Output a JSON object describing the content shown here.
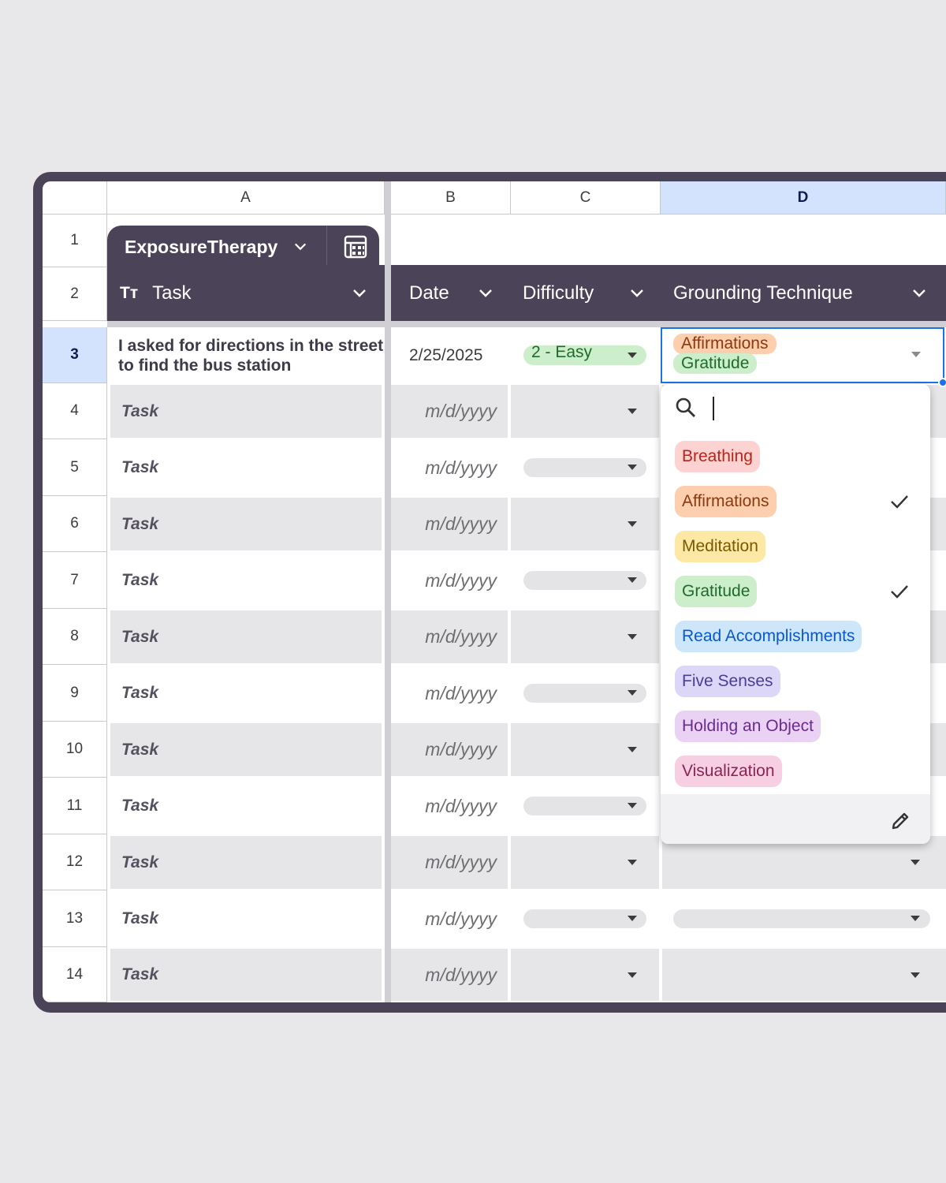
{
  "columns": [
    "A",
    "B",
    "C",
    "D"
  ],
  "row_numbers": [
    "1",
    "2",
    "3",
    "4",
    "5",
    "6",
    "7",
    "8",
    "9",
    "10",
    "11",
    "12",
    "13",
    "14"
  ],
  "table_tab": {
    "name": "ExposureTherapy",
    "icons": [
      "chevron-down-icon",
      "table-calculator-icon"
    ]
  },
  "headers": {
    "task": "Task",
    "task_type_icon": "Tт",
    "date": "Date",
    "difficulty": "Difficulty",
    "grounding": "Grounding Technique"
  },
  "row3": {
    "task": "I asked for directions in the street to find the bus station",
    "date": "2/25/2025",
    "difficulty": "2 - Easy",
    "grounding": [
      "Affirmations",
      "Gratitude"
    ]
  },
  "placeholders": {
    "task": "Task",
    "date": "m/d/yyyy"
  },
  "dropdown": {
    "search_value": "",
    "options": [
      {
        "label": "Breathing",
        "checked": false,
        "bg": "#fcd3d0",
        "fg": "#b3261e"
      },
      {
        "label": "Affirmations",
        "checked": true,
        "bg": "#fdcfae",
        "fg": "#8a3a0e"
      },
      {
        "label": "Meditation",
        "checked": false,
        "bg": "#fde8a6",
        "fg": "#7a5a00"
      },
      {
        "label": "Gratitude",
        "checked": true,
        "bg": "#cdeecb",
        "fg": "#1e6b2c"
      },
      {
        "label": "Read Accomplishments",
        "checked": false,
        "bg": "#cde6fa",
        "fg": "#0b57d0"
      },
      {
        "label": "Five Senses",
        "checked": false,
        "bg": "#dcd7f6",
        "fg": "#4a3d9a"
      },
      {
        "label": "Holding an Object",
        "checked": false,
        "bg": "#ead2f5",
        "fg": "#6a2c8c"
      },
      {
        "label": "Visualization",
        "checked": false,
        "bg": "#f6d0e2",
        "fg": "#8f2254"
      }
    ]
  },
  "colors": {
    "frame": "#4b4358",
    "selection": "#1a73e8",
    "stripe": "#e6e6e9",
    "easy_bg": "#cdeecb",
    "easy_fg": "#1e6b2c"
  }
}
